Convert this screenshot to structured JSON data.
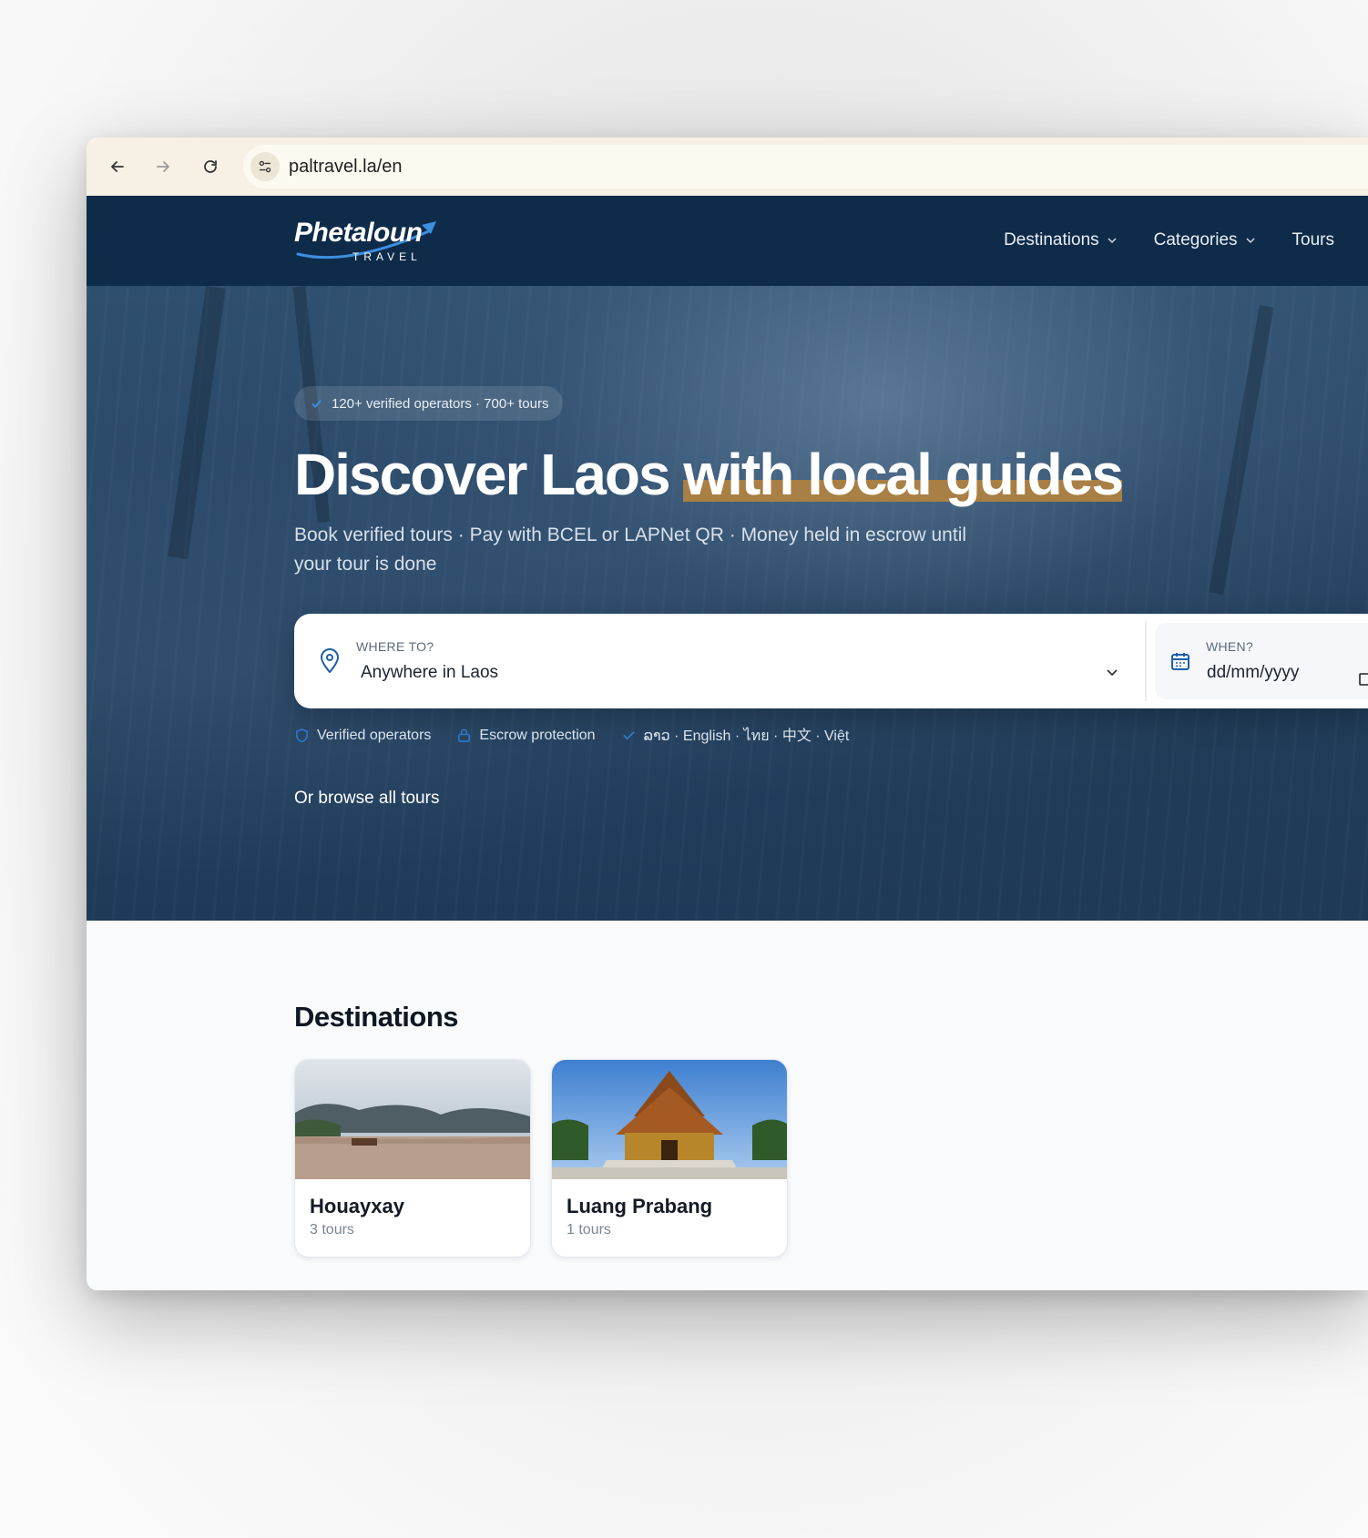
{
  "browser": {
    "url": "paltravel.la/en"
  },
  "site": {
    "logo": {
      "name": "Phetaloun",
      "sub": "TRAVEL"
    },
    "nav": [
      {
        "label": "Destinations"
      },
      {
        "label": "Categories"
      },
      {
        "label": "Tours"
      }
    ]
  },
  "hero": {
    "badge": "120+ verified operators · 700+ tours",
    "title_part1": "Discover Laos ",
    "title_part2": "with local guides",
    "subtitle": "Book verified tours · Pay with BCEL or LAPNet QR · Money held in escrow until your tour is done",
    "search": {
      "where_label": "WHERE TO?",
      "where_value": "Anywhere in Laos",
      "when_label": "WHEN?",
      "when_placeholder": "dd/mm/yyyy"
    },
    "trust": [
      {
        "label": "Verified operators",
        "icon": "shield-icon"
      },
      {
        "label": "Escrow protection",
        "icon": "lock-icon"
      },
      {
        "label": "ລາວ · English · ไทย · 中文 · Việt",
        "icon": "check-icon"
      }
    ],
    "browse_all": "Or browse all tours"
  },
  "destinations": {
    "title": "Destinations",
    "items": [
      {
        "name": "Houayxay",
        "count": "3 tours"
      },
      {
        "name": "Luang Prabang",
        "count": "1 tours"
      }
    ]
  },
  "colors": {
    "header_bg": "#0f2b4a",
    "highlight": "#a87f44",
    "accent_blue": "#1d5fa8"
  }
}
